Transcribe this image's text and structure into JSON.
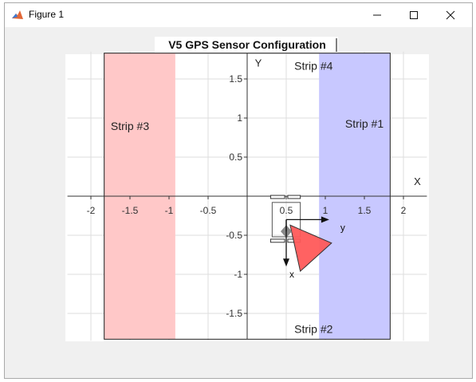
{
  "window": {
    "title": "Figure 1",
    "app_icon": "matlab-icon",
    "controls": [
      "minimize-icon",
      "maximize-icon",
      "close-icon"
    ]
  },
  "chart_data": {
    "type": "area",
    "title": "V5 GPS Sensor Configuration",
    "xlabel": "X",
    "ylabel": "Y",
    "xlim": [
      -2.3,
      2.3
    ],
    "ylim": [
      -1.85,
      1.85
    ],
    "x_ticks": [
      -2,
      -1.5,
      -1,
      -0.5,
      0.5,
      1,
      1.5,
      2
    ],
    "x_tick_labels": [
      "-2",
      "-1.5",
      "-1",
      "-0.5",
      "0.5",
      "1",
      "1.5",
      "2"
    ],
    "y_ticks": [
      1.5,
      1,
      0.5,
      -0.5,
      -1,
      -1.5
    ],
    "y_tick_labels": [
      "1.5",
      "1",
      "0.5",
      "-0.5",
      "-1",
      "-1.5"
    ],
    "grid": true,
    "field_bounds": {
      "x": [
        -1.83,
        1.83
      ],
      "y": [
        -1.83,
        1.83
      ]
    },
    "strips": [
      {
        "label": "Strip #1",
        "x": [
          0.92,
          1.83
        ],
        "y": [
          -1.83,
          1.83
        ],
        "color": "#c8c8ff",
        "label_at": [
          1.5,
          0.93
        ]
      },
      {
        "label": "Strip #2",
        "x": null,
        "y": null,
        "color": null,
        "label_at": [
          0.85,
          -1.7
        ]
      },
      {
        "label": "Strip #3",
        "x": [
          -1.83,
          -0.92
        ],
        "y": [
          -1.83,
          1.83
        ],
        "color": "#ffc8c8",
        "label_at": [
          -1.5,
          0.9
        ]
      },
      {
        "label": "Strip #4",
        "x": null,
        "y": null,
        "color": null,
        "label_at": [
          0.85,
          1.67
        ]
      }
    ],
    "robot": {
      "body": {
        "x": [
          0.32,
          0.68
        ],
        "y": [
          -0.52,
          -0.08
        ]
      },
      "wheels": [
        {
          "x": [
            0.3,
            0.48
          ],
          "y": [
            -0.03,
            0.01
          ]
        },
        {
          "x": [
            0.52,
            0.68
          ],
          "y": [
            -0.03,
            0.01
          ]
        },
        {
          "x": [
            0.3,
            0.48
          ],
          "y": [
            -0.59,
            -0.55
          ]
        },
        {
          "x": [
            0.52,
            0.68
          ],
          "y": [
            -0.59,
            -0.55
          ]
        }
      ],
      "center": [
        0.5,
        -0.45
      ],
      "axis_y_label": "y",
      "axis_x_label": "x",
      "axis_y_tip": [
        1.05,
        -0.3
      ],
      "axis_x_tip": [
        0.5,
        -0.9
      ]
    },
    "sensor_fov": {
      "polygon": [
        [
          0.55,
          -0.37
        ],
        [
          1.08,
          -0.6
        ],
        [
          0.68,
          -0.96
        ]
      ],
      "color": "#ff5a5a"
    }
  }
}
